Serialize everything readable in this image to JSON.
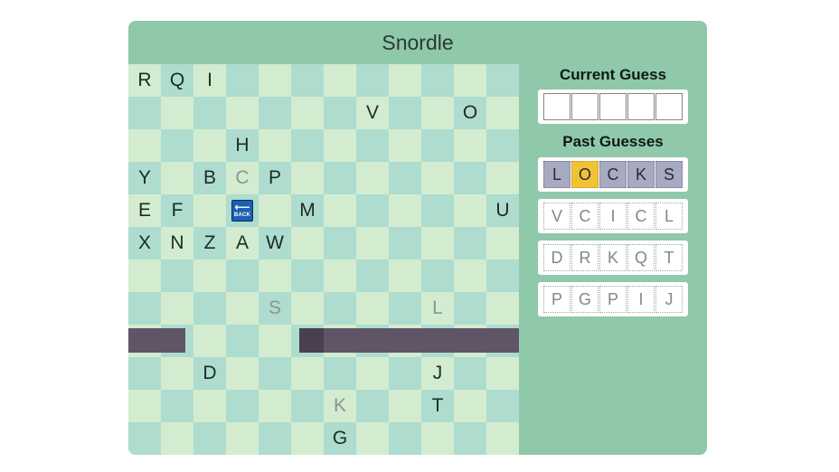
{
  "game": {
    "title": "Snordle",
    "board": {
      "size": 12,
      "letters": [
        {
          "row": 0,
          "col": 0,
          "letter": "R"
        },
        {
          "row": 0,
          "col": 1,
          "letter": "Q"
        },
        {
          "row": 0,
          "col": 2,
          "letter": "I"
        },
        {
          "row": 1,
          "col": 7,
          "letter": "V"
        },
        {
          "row": 1,
          "col": 10,
          "letter": "O"
        },
        {
          "row": 2,
          "col": 3,
          "letter": "H"
        },
        {
          "row": 3,
          "col": 0,
          "letter": "Y"
        },
        {
          "row": 3,
          "col": 2,
          "letter": "B"
        },
        {
          "row": 3,
          "col": 3,
          "letter": "C",
          "faded": true
        },
        {
          "row": 3,
          "col": 4,
          "letter": "P"
        },
        {
          "row": 4,
          "col": 0,
          "letter": "E"
        },
        {
          "row": 4,
          "col": 1,
          "letter": "F"
        },
        {
          "row": 4,
          "col": 5,
          "letter": "M"
        },
        {
          "row": 4,
          "col": 11,
          "letter": "U"
        },
        {
          "row": 5,
          "col": 0,
          "letter": "X"
        },
        {
          "row": 5,
          "col": 1,
          "letter": "N"
        },
        {
          "row": 5,
          "col": 2,
          "letter": "Z"
        },
        {
          "row": 5,
          "col": 3,
          "letter": "A"
        },
        {
          "row": 5,
          "col": 4,
          "letter": "W"
        },
        {
          "row": 7,
          "col": 4,
          "letter": "S",
          "faded": true
        },
        {
          "row": 7,
          "col": 9,
          "letter": "L",
          "faded": true
        },
        {
          "row": 9,
          "col": 2,
          "letter": "D"
        },
        {
          "row": 9,
          "col": 9,
          "letter": "J"
        },
        {
          "row": 10,
          "col": 6,
          "letter": "K",
          "faded": true
        },
        {
          "row": 10,
          "col": 9,
          "letter": "T"
        },
        {
          "row": 11,
          "col": 6,
          "letter": "G"
        }
      ],
      "back_key": {
        "row": 4,
        "col": 3,
        "label": "BACK",
        "arrow": "⟵"
      }
    },
    "current_guess": {
      "label": "Current Guess",
      "letters": [
        "",
        "",
        "",
        "",
        ""
      ]
    },
    "past_guesses": {
      "label": "Past Guesses",
      "rows": [
        [
          {
            "letter": "L",
            "state": "gray"
          },
          {
            "letter": "O",
            "state": "yellow"
          },
          {
            "letter": "C",
            "state": "gray"
          },
          {
            "letter": "K",
            "state": "gray"
          },
          {
            "letter": "S",
            "state": "gray"
          }
        ],
        [
          {
            "letter": "V",
            "state": "pending"
          },
          {
            "letter": "C",
            "state": "pending"
          },
          {
            "letter": "I",
            "state": "pending"
          },
          {
            "letter": "C",
            "state": "pending"
          },
          {
            "letter": "L",
            "state": "pending"
          }
        ],
        [
          {
            "letter": "D",
            "state": "pending"
          },
          {
            "letter": "R",
            "state": "pending"
          },
          {
            "letter": "K",
            "state": "pending"
          },
          {
            "letter": "Q",
            "state": "pending"
          },
          {
            "letter": "T",
            "state": "pending"
          }
        ],
        [
          {
            "letter": "P",
            "state": "pending"
          },
          {
            "letter": "G",
            "state": "pending"
          },
          {
            "letter": "P",
            "state": "pending"
          },
          {
            "letter": "I",
            "state": "pending"
          },
          {
            "letter": "J",
            "state": "pending"
          }
        ]
      ]
    },
    "colors": {
      "panel": "#90c8aa",
      "cell_light": "#d3ecd0",
      "cell_dark": "#aedccf",
      "snake": "#5f5566",
      "yellow": "#f1c232",
      "gray": "#a8aac2"
    }
  }
}
